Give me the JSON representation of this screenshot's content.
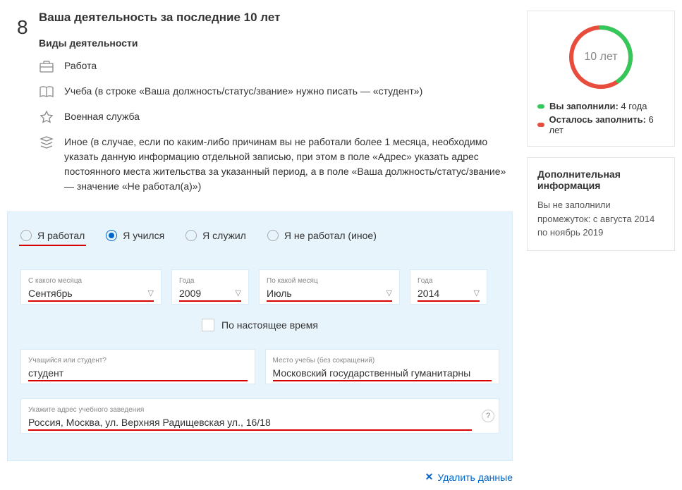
{
  "section": {
    "number": "8",
    "title": "Ваша деятельность за последние 10 лет",
    "types_header": "Виды деятельности",
    "items": {
      "work": "Работа",
      "study": "Учеба (в строке «Ваша должность/статус/звание» нужно писать — «студент»)",
      "military": "Военная служба",
      "other": "Иное (в случае, если по каким-либо причинам вы не работали более 1 месяца, необходимо указать данную информацию отдельной записью, при этом в поле «Адрес» указать адрес постоянного места жительства за указанный период, а в поле «Ваша должность/статус/звание» — значение «Не работал(а)»)"
    }
  },
  "radios": {
    "worked": "Я работал",
    "studied": "Я учился",
    "served": "Я служил",
    "no_work": "Я не работал (иное)"
  },
  "labels": {
    "from_month": "С какого месяца",
    "from_year": "Года",
    "to_month": "По какой месяц",
    "to_year": "Года",
    "present": "По настоящее время",
    "status": "Учащийся или студент?",
    "place": "Место учебы (без сокращений)",
    "address": "Укажите адрес учебного заведения",
    "help": "?"
  },
  "values": {
    "from_month": "Сентябрь",
    "from_year": "2009",
    "to_month": "Июль",
    "to_year": "2014",
    "status": "студент",
    "place": "Московский государственный гуманитарны",
    "address": "Россия, Москва, ул. Верхняя Радищевская ул., 16/18"
  },
  "actions": {
    "delete": "Удалить данные"
  },
  "side": {
    "donut_label": "10 лет",
    "filled_label": "Вы заполнили:",
    "filled_value": "4 года",
    "remaining_label": "Осталось заполнить:",
    "remaining_value": "6 лет",
    "donut_filled": 40,
    "info_title": "Дополнительная информация",
    "info_text": "Вы не заполнили промежуток: с августа 2014 по ноябрь 2019"
  },
  "chart_data": {
    "type": "pie",
    "title": "10 лет",
    "series": [
      {
        "name": "Вы заполнили",
        "value": 4,
        "label": "4 года",
        "color": "#34c759"
      },
      {
        "name": "Осталось заполнить",
        "value": 6,
        "label": "6 лет",
        "color": "#e84c3d"
      }
    ]
  }
}
